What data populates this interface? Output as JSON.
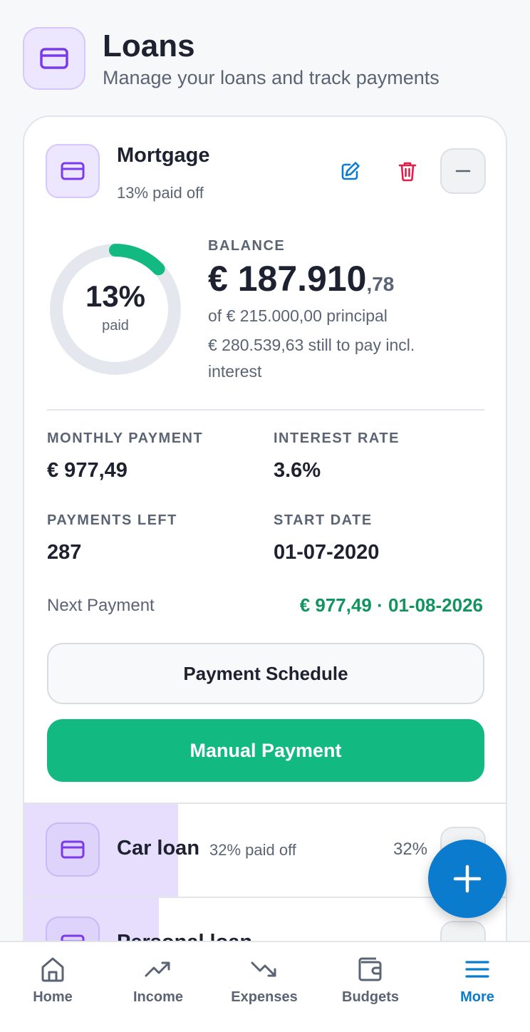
{
  "header": {
    "title": "Loans",
    "subtitle": "Manage your loans and track payments",
    "icon": "credit-card-icon"
  },
  "loan": {
    "name": "Mortgage",
    "paid_off_text": "13% paid off",
    "paid_fraction": 0.13,
    "ring_percent": "13%",
    "ring_label": "paid",
    "balance_label": "BALANCE",
    "balance_main": "€ 187.910",
    "balance_cents": ",78",
    "principal_text": "of € 215.000,00 principal",
    "remaining_text": "€ 280.539,63 still to pay incl. interest",
    "stats": {
      "monthly_label": "MONTHLY PAYMENT",
      "monthly_value": "€ 977,49",
      "rate_label": "INTEREST RATE",
      "rate_value": "3.6%",
      "left_label": "PAYMENTS LEFT",
      "left_value": "287",
      "start_label": "START DATE",
      "start_value": "01-07-2020"
    },
    "next_label": "Next Payment",
    "next_value": "€ 977,49 · 01-08-2026",
    "schedule_button": "Payment Schedule",
    "manual_button": "Manual Payment"
  },
  "other_loans": [
    {
      "name": "Car loan",
      "sub": "32% paid off",
      "percent": "32%",
      "paid_fraction": 0.32
    },
    {
      "name": "Personal loan",
      "paid_fraction": 0.28
    }
  ],
  "nav": [
    {
      "label": "Home",
      "icon": "home-icon"
    },
    {
      "label": "Income",
      "icon": "trending-up-icon"
    },
    {
      "label": "Expenses",
      "icon": "trending-down-icon"
    },
    {
      "label": "Budgets",
      "icon": "wallet-icon"
    },
    {
      "label": "More",
      "icon": "menu-icon",
      "active": true
    }
  ],
  "colors": {
    "accent": "#0b7ccd",
    "success": "#12b981",
    "brand_purple": "#7c3aed",
    "danger": "#e11d48"
  }
}
